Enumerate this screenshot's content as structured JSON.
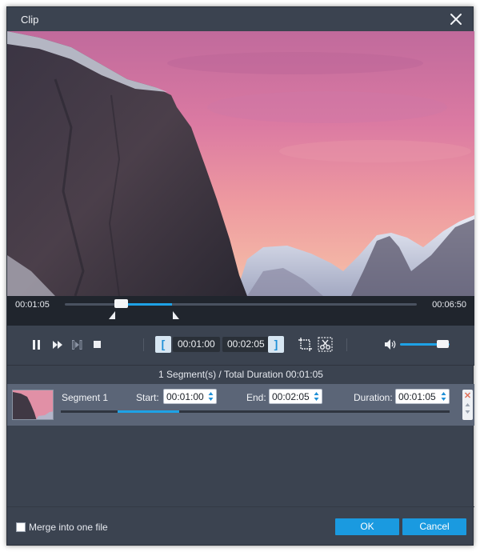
{
  "window": {
    "title": "Clip"
  },
  "player": {
    "current_time": "00:01:05",
    "total_time": "00:06:50",
    "playhead_fraction": 0.158,
    "selection_start_fraction": 0.146,
    "selection_end_fraction": 0.305
  },
  "controls": {
    "start_time": "00:01:00",
    "end_time": "00:02:05",
    "volume_fraction": 0.85,
    "icons": [
      "pause-icon",
      "fast-forward-icon",
      "next-frame-icon",
      "stop-icon",
      "set-start-icon",
      "set-end-icon",
      "crop-icon",
      "scissors-icon",
      "volume-icon"
    ]
  },
  "summary": "1 Segment(s) / Total Duration 00:01:05",
  "segments": [
    {
      "name": "Segment 1",
      "start_label": "Start:",
      "start": "00:01:00",
      "end_label": "End:",
      "end": "00:02:05",
      "duration_label": "Duration:",
      "duration": "00:01:05",
      "range_start_fraction": 0.146,
      "range_end_fraction": 0.305
    }
  ],
  "footer": {
    "merge_label": "Merge into one file",
    "merge_checked": false,
    "ok_label": "OK",
    "cancel_label": "Cancel"
  },
  "colors": {
    "accent": "#1a9ae0",
    "panel": "#3b4350",
    "segment_row": "#5b6577"
  }
}
